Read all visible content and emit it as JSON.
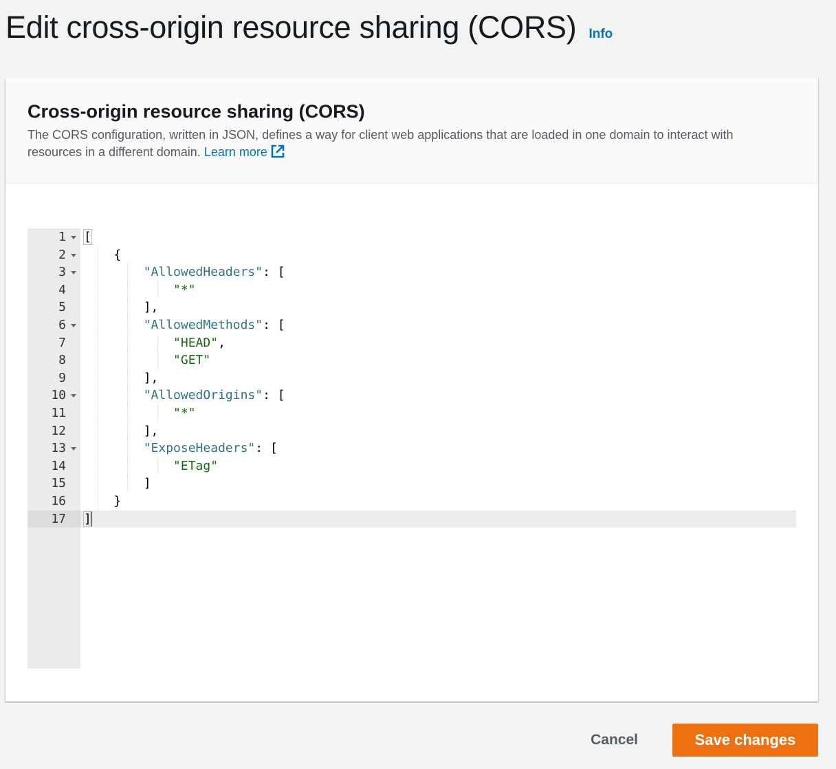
{
  "page": {
    "title": "Edit cross-origin resource sharing (CORS)",
    "info_label": "Info"
  },
  "panel": {
    "title": "Cross-origin resource sharing (CORS)",
    "description": "The CORS configuration, written in JSON, defines a way for client web applications that are loaded in one domain to interact with resources in a different domain.",
    "learn_more_label": "Learn more",
    "external_icon": "external-link-icon"
  },
  "editor": {
    "line_numbers": [
      "1",
      "2",
      "3",
      "4",
      "5",
      "6",
      "7",
      "8",
      "9",
      "10",
      "11",
      "12",
      "13",
      "14",
      "15",
      "16",
      "17"
    ],
    "active_line": 17,
    "code_lines": [
      "[",
      "    {",
      "        \"AllowedHeaders\": [",
      "            \"*\"",
      "        ],",
      "        \"AllowedMethods\": [",
      "            \"HEAD\",",
      "            \"GET\"",
      "        ],",
      "        \"AllowedOrigins\": [",
      "            \"*\"",
      "        ],",
      "        \"ExposeHeaders\": [",
      "            \"ETag\"",
      "        ]",
      "    }",
      "]"
    ]
  },
  "actions": {
    "cancel_label": "Cancel",
    "save_label": "Save changes"
  },
  "colors": {
    "link": "#0073bb",
    "primary_button": "#ec7211",
    "json_key": "#31747e",
    "json_string": "#1a6b12"
  }
}
